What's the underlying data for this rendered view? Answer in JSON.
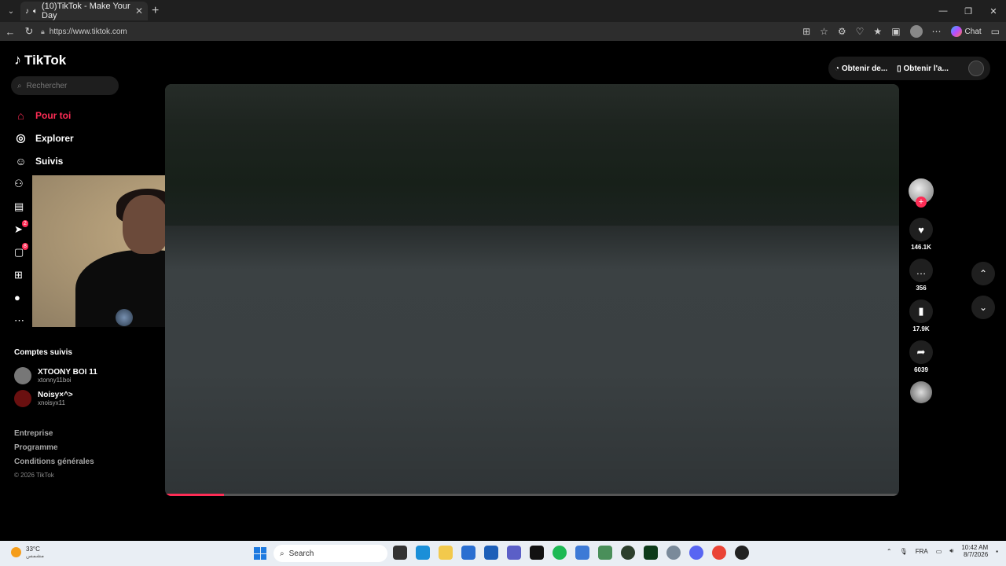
{
  "browser": {
    "tab_title": "(10)TikTok - Make Your Day",
    "url": "https://www.tiktok.com",
    "chat_label": "Chat"
  },
  "tiktok": {
    "logo": "TikTok",
    "search_placeholder": "Rechercher",
    "nav": [
      {
        "label": "Pour toi",
        "icon": "home-icon",
        "active": true
      },
      {
        "label": "Explorer",
        "icon": "compass-icon"
      },
      {
        "label": "Suivis",
        "icon": "user-plus-icon"
      }
    ],
    "nav_icons": [
      {
        "icon": "friends-icon"
      },
      {
        "icon": "live-icon"
      },
      {
        "icon": "messages-icon",
        "badge": "2"
      },
      {
        "icon": "inbox-icon",
        "badge": "8"
      },
      {
        "icon": "upload-icon"
      },
      {
        "icon": "profile-icon"
      },
      {
        "icon": "more-icon"
      }
    ],
    "following_title": "Comptes suivis",
    "accounts": [
      {
        "name": "XTOONY BOI 11",
        "handle": "xtonny11boi"
      },
      {
        "name": "Noisy×^>",
        "handle": "xnoisyx11"
      }
    ],
    "footer": [
      "Entreprise",
      "Programme",
      "Conditions générales"
    ],
    "copyright": "© 2026 TikTok",
    "top_buttons": [
      "Obtenir de...",
      "Obtenir l'a..."
    ],
    "actions": {
      "likes": "146.1K",
      "comments": "356",
      "saves": "17.9K",
      "shares": "6039"
    },
    "video_progress": 0.08
  },
  "taskbar": {
    "temperature": "33°C",
    "weather_sub": "مشمس",
    "search_label": "Search",
    "lang": "FRA",
    "time": "10:42 AM",
    "date": "8/7/2026"
  }
}
